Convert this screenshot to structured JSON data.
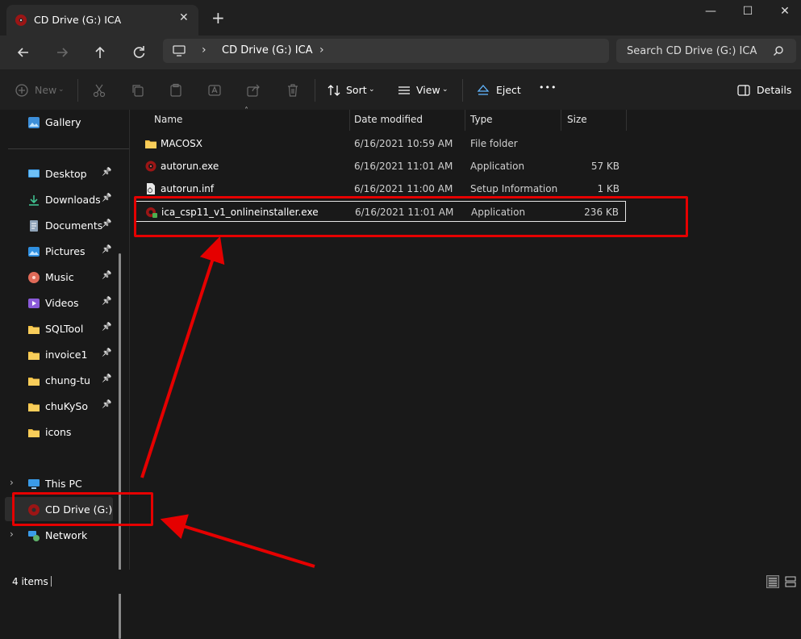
{
  "window": {
    "tab_title": "CD Drive (G:) ICA",
    "new_tab": "+",
    "controls": {
      "minimize": "—",
      "maximize": "☐",
      "close": "✕"
    }
  },
  "address_bar": {
    "path": "CD Drive (G:) ICA",
    "search_placeholder": "Search CD Drive (G:) ICA"
  },
  "toolbar": {
    "new_label": "New",
    "sort_label": "Sort",
    "view_label": "View",
    "eject_label": "Eject",
    "more_label": "•••",
    "details_label": "Details"
  },
  "sidebar": {
    "gallery": "Gallery",
    "quick_access": [
      {
        "label": "Desktop",
        "icon": "desktop-icon"
      },
      {
        "label": "Downloads",
        "icon": "downloads-icon"
      },
      {
        "label": "Documents",
        "icon": "documents-icon"
      },
      {
        "label": "Pictures",
        "icon": "pictures-icon"
      },
      {
        "label": "Music",
        "icon": "music-icon"
      },
      {
        "label": "Videos",
        "icon": "videos-icon"
      },
      {
        "label": "SQLTool",
        "icon": "folder-icon"
      },
      {
        "label": "invoice1",
        "icon": "folder-icon"
      },
      {
        "label": "chung-tu",
        "icon": "folder-icon"
      },
      {
        "label": "chuKySo",
        "icon": "folder-icon"
      },
      {
        "label": "icons",
        "icon": "folder-icon"
      }
    ],
    "this_pc": "This PC",
    "cd_drive": "CD Drive (G:) ICA",
    "network": "Network"
  },
  "columns": {
    "name": "Name",
    "date": "Date modified",
    "type": "Type",
    "size": "Size"
  },
  "files": [
    {
      "name": "MACOSX",
      "date": "6/16/2021 10:59 AM",
      "type": "File folder",
      "size": "",
      "icon": "folder-icon"
    },
    {
      "name": "autorun.exe",
      "date": "6/16/2021 11:01 AM",
      "type": "Application",
      "size": "57 KB",
      "icon": "app-icon"
    },
    {
      "name": "autorun.inf",
      "date": "6/16/2021 11:00 AM",
      "type": "Setup Information",
      "size": "1 KB",
      "icon": "inf-file-icon"
    },
    {
      "name": "ica_csp11_v1_onlineinstaller.exe",
      "date": "6/16/2021 11:01 AM",
      "type": "Application",
      "size": "236 KB",
      "icon": "installer-icon"
    }
  ],
  "status": {
    "item_count": "4 items"
  },
  "colors": {
    "annotation_red": "#e50000",
    "background": "#191919",
    "folder": "#f5c142"
  }
}
